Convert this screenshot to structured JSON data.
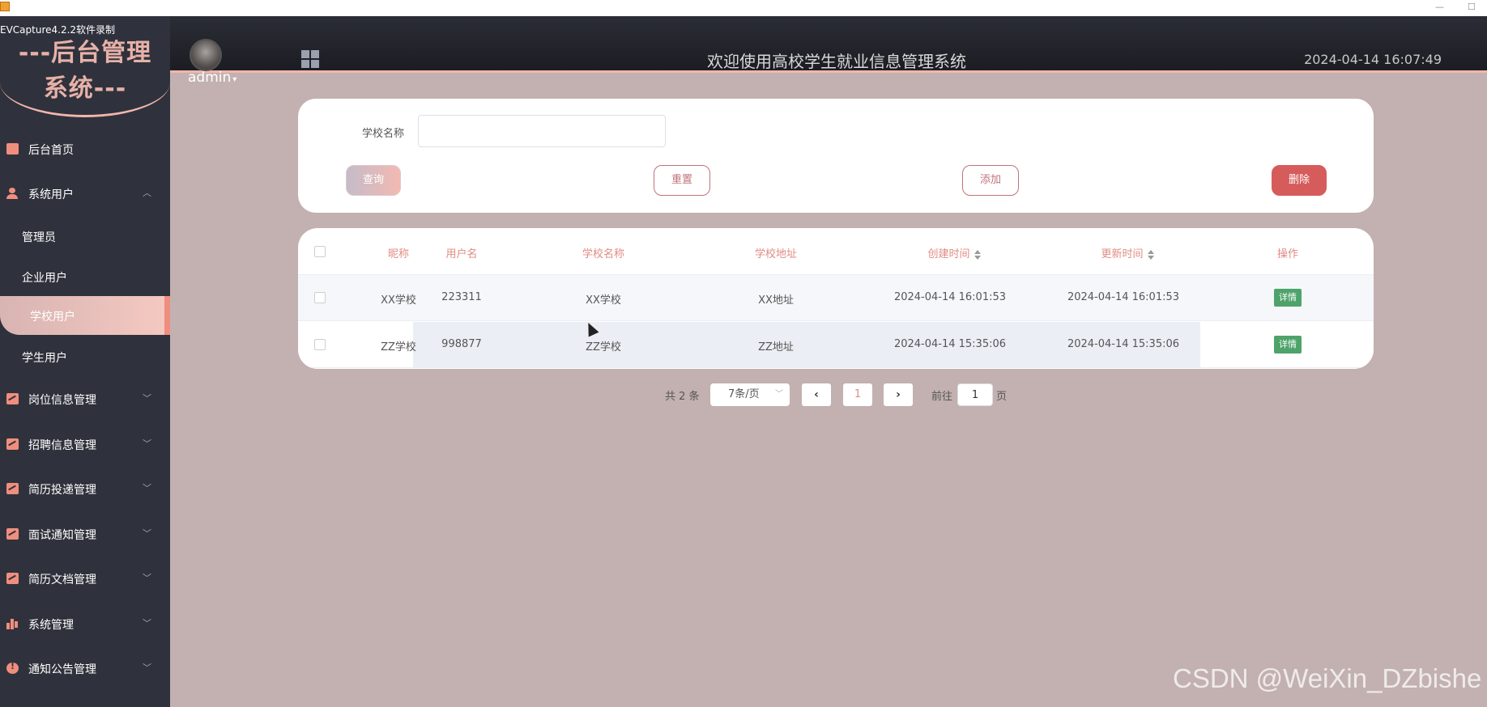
{
  "window": {
    "recorder_label": "EVCapture4.2.2软件录制",
    "minimize_glyph": "—",
    "maximize_glyph": "☐"
  },
  "header": {
    "logo_line1": "---后台管理",
    "logo_line2": "系统---",
    "username": "admin",
    "title": "欢迎使用高校学生就业信息管理系统",
    "datetime": "2024-04-14 16:07:49"
  },
  "sidebar": {
    "items": [
      {
        "label": "后台首页",
        "icon": "monitor-icon"
      },
      {
        "label": "系统用户",
        "icon": "user-icon",
        "expanded": true
      },
      {
        "label": "岗位信息管理",
        "icon": "chart-icon"
      },
      {
        "label": "招聘信息管理",
        "icon": "chart-icon"
      },
      {
        "label": "简历投递管理",
        "icon": "chart-icon"
      },
      {
        "label": "面试通知管理",
        "icon": "chart-icon"
      },
      {
        "label": "简历文档管理",
        "icon": "chart-icon"
      },
      {
        "label": "系统管理",
        "icon": "bar-chart-icon"
      },
      {
        "label": "通知公告管理",
        "icon": "info-icon"
      }
    ],
    "subitems": [
      {
        "label": "管理员"
      },
      {
        "label": "企业用户"
      },
      {
        "label": "学校用户",
        "active": true
      },
      {
        "label": "学生用户"
      }
    ]
  },
  "search": {
    "label": "学校名称",
    "value": "",
    "placeholder": "",
    "query_label": "查询",
    "reset_label": "重置",
    "add_label": "添加",
    "delete_label": "删除"
  },
  "table": {
    "columns": [
      "昵称",
      "用户名",
      "学校名称",
      "学校地址",
      "创建时间",
      "更新时间",
      "操作"
    ],
    "rows": [
      {
        "nickname": "XX学校",
        "username": "223311",
        "school": "XX学校",
        "address": "XX地址",
        "created": "2024-04-14 16:01:53",
        "updated": "2024-04-14 16:01:53",
        "action": "详情"
      },
      {
        "nickname": "ZZ学校",
        "username": "998877",
        "school": "ZZ学校",
        "address": "ZZ地址",
        "created": "2024-04-14 15:35:06",
        "updated": "2024-04-14 15:35:06",
        "action": "详情"
      }
    ]
  },
  "pagination": {
    "total": "共 2 条",
    "page_size": "7条/页",
    "current": "1",
    "goto_label": "前往",
    "goto_value": "1",
    "page_suffix": "页"
  },
  "watermark": "CSDN @WeiXin_DZbishe",
  "colors": {
    "accent": "#f08e7e",
    "sidebar_bg": "#2f323c",
    "page_bg": "#c2b1b0",
    "delete": "#d65c5c",
    "detail": "#4ea36a"
  }
}
